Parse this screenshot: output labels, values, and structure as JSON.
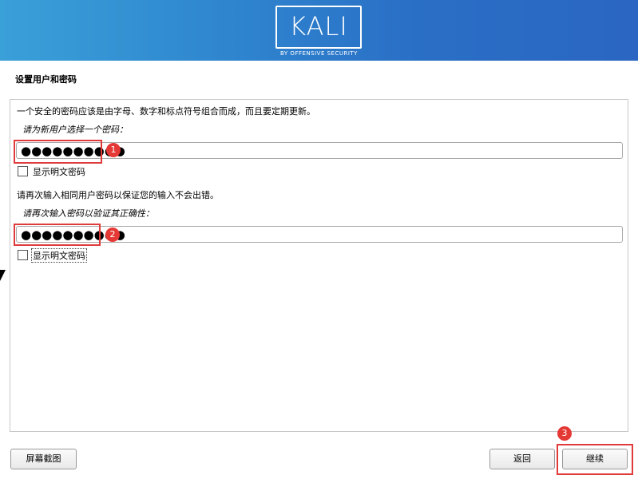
{
  "header": {
    "logo_text": "KALI",
    "logo_sub": "BY OFFENSIVE SECURITY"
  },
  "page": {
    "title": "设置用户和密码",
    "intro": "一个安全的密码应该是由字母、数字和标点符号组合而成，而且要定期更新。",
    "prompt1": "请为新用户选择一个密码：",
    "password1": "●●●●●●●●●●",
    "show_plain1": "显示明文密码",
    "reenter_note": "请再次输入相同用户密码以保证您的输入不会出错。",
    "prompt2": "请再次输入密码以验证其正确性：",
    "password2": "●●●●●●●●●●",
    "show_plain2": "显示明文密码"
  },
  "annotations": {
    "badge1": "1",
    "badge2": "2",
    "badge3": "3",
    "color": "#e03b3b"
  },
  "footer": {
    "screenshot_label": "屏幕截图",
    "back_label": "返回",
    "continue_label": "继续"
  }
}
